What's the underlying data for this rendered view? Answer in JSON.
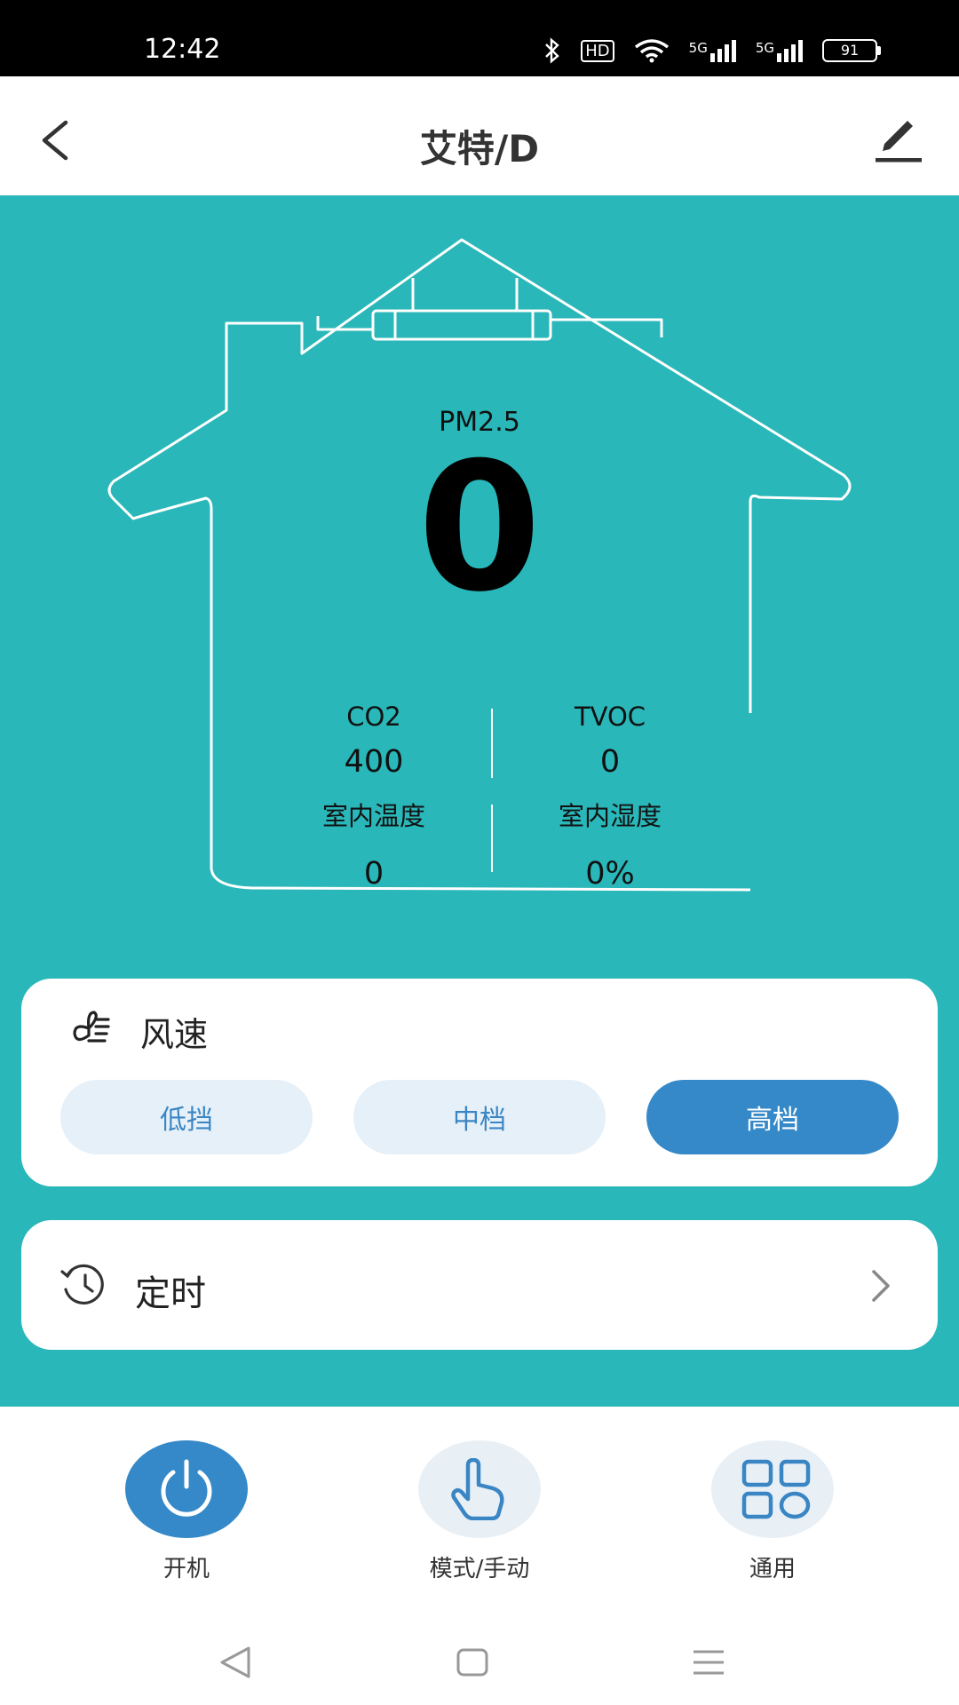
{
  "status_bar": {
    "time": "12:42",
    "network_1": "5G",
    "network_2": "5G",
    "battery": "91",
    "hd_badge": "HD"
  },
  "header": {
    "title": "艾特/D",
    "back_icon": "back-arrow-icon",
    "edit_icon": "edit-pencil-icon"
  },
  "air": {
    "pm_label": "PM2.5",
    "pm_value": "0",
    "co2_label": "CO2",
    "co2_value": "400",
    "tvoc_label": "TVOC",
    "tvoc_value": "0",
    "temp_label": "室内温度",
    "temp_value": "0",
    "humidity_label": "室内湿度",
    "humidity_value": "0%"
  },
  "wind": {
    "title": "风速",
    "options": [
      "低挡",
      "中档",
      "高档"
    ],
    "selected": "高档"
  },
  "timer": {
    "title": "定时"
  },
  "bottom_nav": [
    {
      "label": "开机",
      "icon": "power-icon",
      "active": true
    },
    {
      "label": "模式/手动",
      "icon": "hand-pointer-icon",
      "active": false
    },
    {
      "label": "通用",
      "icon": "grid-icon",
      "active": false
    }
  ],
  "colors": {
    "main_bg": "#2ab7b9",
    "accent": "#3589c8",
    "button_bg": "#e6f0f8"
  }
}
